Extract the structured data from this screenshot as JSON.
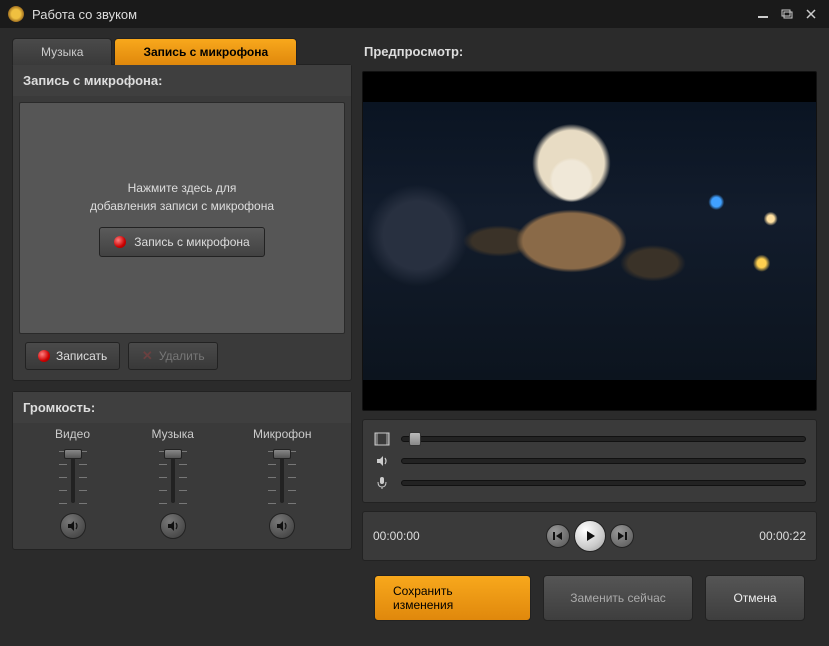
{
  "titlebar": {
    "title": "Работа со звуком"
  },
  "tabs": {
    "music": "Музыка",
    "mic": "Запись с микрофона"
  },
  "rec_panel": {
    "header": "Запись с микрофона:",
    "hint_line1": "Нажмите здесь для",
    "hint_line2": "добавления записи с микрофона",
    "record_btn": "Запись с микрофона",
    "record_small": "Записать",
    "delete_small": "Удалить"
  },
  "volume": {
    "header": "Громкость:",
    "video": "Видео",
    "music": "Музыка",
    "mic": "Микрофон"
  },
  "preview": {
    "header": "Предпросмотр:"
  },
  "time": {
    "current": "00:00:00",
    "total": "00:00:22"
  },
  "footer": {
    "save": "Сохранить изменения",
    "replace": "Заменить сейчас",
    "cancel": "Отмена"
  }
}
